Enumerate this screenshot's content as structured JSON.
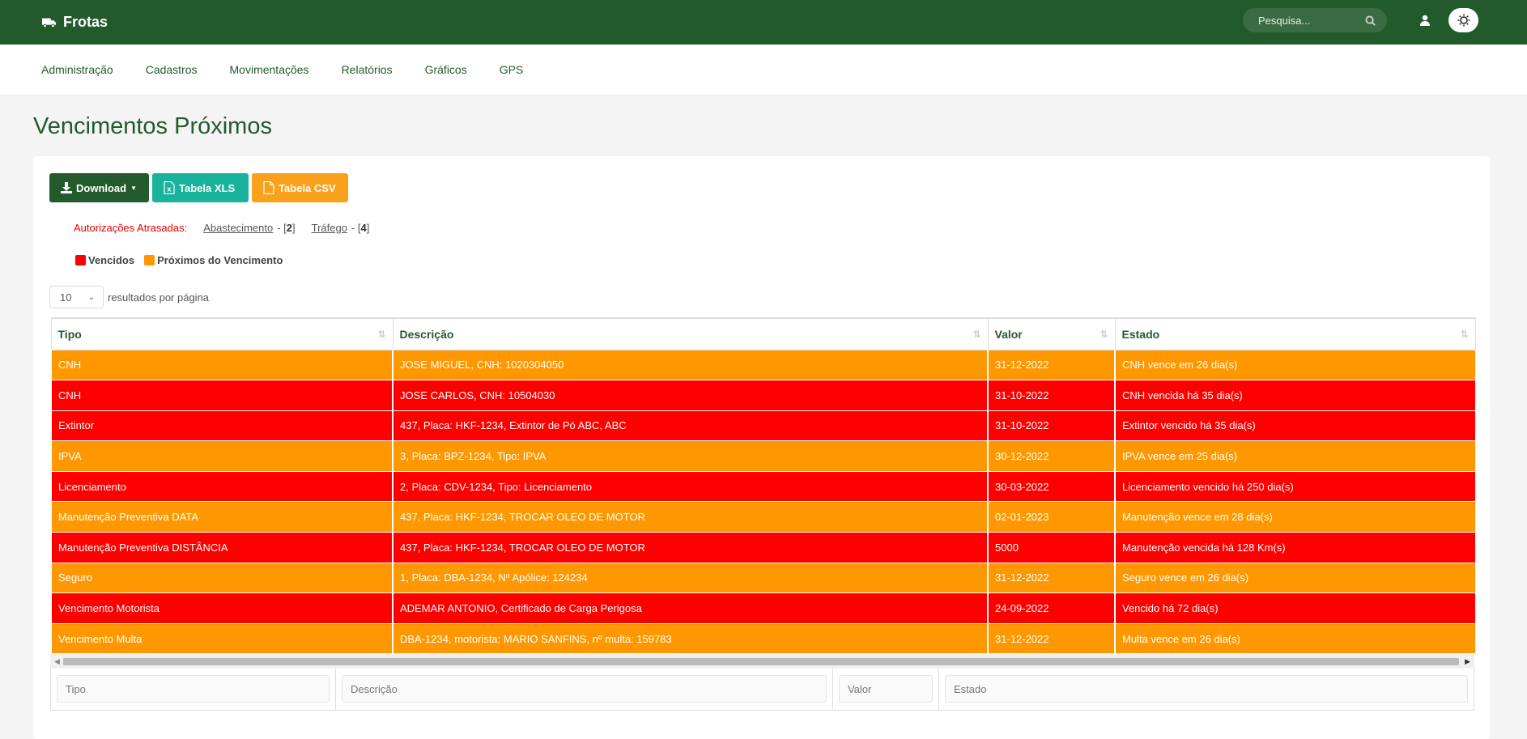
{
  "app": {
    "title": "Frotas"
  },
  "search": {
    "placeholder": "Pesquisa..."
  },
  "nav": [
    {
      "label": "Administração"
    },
    {
      "label": "Cadastros"
    },
    {
      "label": "Movimentações"
    },
    {
      "label": "Relatórios"
    },
    {
      "label": "Gráficos"
    },
    {
      "label": "GPS"
    }
  ],
  "page": {
    "title": "Vencimentos Próximos"
  },
  "buttons": {
    "download": "Download",
    "xls": "Tabela XLS",
    "csv": "Tabela CSV"
  },
  "auth": {
    "label": "Autorizações Atrasadas:",
    "links": [
      {
        "label": "Abastecimento",
        "count": "2"
      },
      {
        "label": "Tráfego",
        "count": "4"
      }
    ]
  },
  "legend": [
    {
      "label": "Vencidos",
      "color": "#ff0000"
    },
    {
      "label": "Próximos do Vencimento",
      "color": "#ff9800"
    }
  ],
  "lengths": {
    "value": "10",
    "suffix": "resultados por página"
  },
  "table": {
    "columns": [
      "Tipo",
      "Descrição",
      "Valor",
      "Estado"
    ],
    "rows": [
      {
        "status": "orange",
        "cells": [
          "CNH",
          "JOSE MIGUEL, CNH: 1020304050",
          "31-12-2022",
          "CNH vence em 26 dia(s)"
        ]
      },
      {
        "status": "red",
        "cells": [
          "CNH",
          "JOSE CARLOS, CNH: 10504030",
          "31-10-2022",
          "CNH vencida há 35 dia(s)"
        ]
      },
      {
        "status": "red",
        "cells": [
          "Extintor",
          "437, Placa: HKF-1234, Extintor de Pó ABC, ABC",
          "31-10-2022",
          "Extintor vencido há 35 dia(s)"
        ]
      },
      {
        "status": "orange",
        "cells": [
          "IPVA",
          "3, Placa: BPZ-1234, Tipo: IPVA",
          "30-12-2022",
          "IPVA vence em 25 dia(s)"
        ]
      },
      {
        "status": "red",
        "cells": [
          "Licenciamento",
          "2, Placa: CDV-1234, Tipo: Licenciamento",
          "30-03-2022",
          "Licenciamento vencido há 250 dia(s)"
        ]
      },
      {
        "status": "orange",
        "cells": [
          "Manutenção Preventiva DATA",
          "437, Placa: HKF-1234, TROCAR OLEO DE MOTOR",
          "02-01-2023",
          "Manutenção vence em 28 dia(s)"
        ]
      },
      {
        "status": "red",
        "cells": [
          "Manutenção Preventiva DISTÂNCIA",
          "437, Placa: HKF-1234, TROCAR OLEO DE MOTOR",
          "5000",
          "Manutenção vencida há 128 Km(s)"
        ]
      },
      {
        "status": "orange",
        "cells": [
          "Seguro",
          "1, Placa: DBA-1234, Nº Apólice: 124234",
          "31-12-2022",
          "Seguro vence em 26 dia(s)"
        ]
      },
      {
        "status": "red",
        "cells": [
          "Vencimento Motorista",
          "ADEMAR ANTONIO, Certificado de Carga Perigosa",
          "24-09-2022",
          "Vencido há 72 dia(s)"
        ]
      },
      {
        "status": "orange",
        "cells": [
          "Vencimento Multa",
          "DBA-1234, motorista: MARIO SANFINS, nº multa: 159783",
          "31-12-2022",
          "Multa vence em 26 dia(s)"
        ]
      }
    ],
    "filter_placeholders": [
      "Tipo",
      "Descrição",
      "Valor",
      "Estado"
    ]
  }
}
